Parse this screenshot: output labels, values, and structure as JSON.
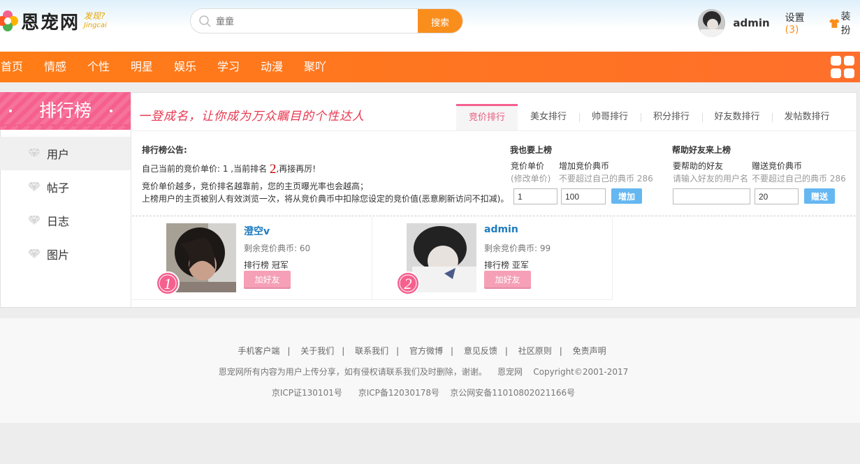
{
  "header": {
    "logo_text": "恩宠网",
    "logo_slogan_1": "发现?",
    "logo_slogan_2": "Jingcai",
    "search_placeholder": "童童",
    "search_button": "搜索",
    "username": "admin",
    "settings_label": "设置",
    "settings_count": "(3)",
    "dress_label": "装扮"
  },
  "nav": [
    "首页",
    "情感",
    "个性",
    "明星",
    "娱乐",
    "学习",
    "动漫",
    "聚吖"
  ],
  "sidebar": {
    "title": "排行榜",
    "items": [
      "用户",
      "帖子",
      "日志",
      "图片"
    ]
  },
  "main": {
    "slogan": "一登成名，让你成为万众瞩目的个性达人",
    "tabs": [
      "竞价排行",
      "美女排行",
      "帅哥排行",
      "积分排行",
      "好友数排行",
      "发帖数排行"
    ],
    "notice_title": "排行榜公告:",
    "notice_line1_a": "自己当前的竞价单价: 1 ,当前排名",
    "notice_rank": "2",
    "notice_line1_b": ",再接再厉!",
    "notice_line2": "竞价单价越多，竞价排名越靠前，您的主页曝光率也会越高；",
    "notice_line3": "上榜用户的主页被别人有效浏览一次，将从竞价典币中扣除您设定的竞价值(恶意刷新访问不扣减)。",
    "bid": {
      "title": "我也要上榜",
      "label_price": "竞价单价",
      "hint_price": "(修改单价)",
      "label_add": "增加竞价典币",
      "hint_add": "不要超过自己的典币 286",
      "price_value": "1",
      "add_value": "100",
      "button": "增加"
    },
    "help": {
      "title": "帮助好友来上榜",
      "label_friend": "要帮助的好友",
      "hint_friend": "请输入好友的用户名",
      "label_gift": "赠送竞价典币",
      "hint_gift": "不要超过自己的典币 286",
      "friend_value": "",
      "gift_value": "20",
      "button": "赠送"
    },
    "cards": [
      {
        "name": "澄空v",
        "coins": "剩余竞价典币: 60",
        "rank_label": "排行榜 冠军",
        "badge": "1",
        "add_button": "加好友"
      },
      {
        "name": "admin",
        "coins": "剩余竞价典币: 99",
        "rank_label": "排行榜 亚军",
        "badge": "2",
        "add_button": "加好友"
      }
    ]
  },
  "footer": {
    "links": [
      "手机客户端",
      "关于我们",
      "联系我们",
      "官方微博",
      "意见反馈",
      "社区原则",
      "免责声明"
    ],
    "line2_a": "恩宠网所有内容为用户上传分享，如有侵权请联系我们及时删除，谢谢。",
    "line2_b": "恩宠网",
    "line2_c": "Copyright©2001-2017",
    "line3_a": "京ICP证130101号",
    "line3_b": "京ICP备12030178号",
    "line3_c": "京公网安备11010802021166号"
  },
  "colors": {
    "accent": "#ff7c16",
    "pink": "#f5608e",
    "blue": "#65b7f1",
    "link": "#1e7bbf"
  }
}
